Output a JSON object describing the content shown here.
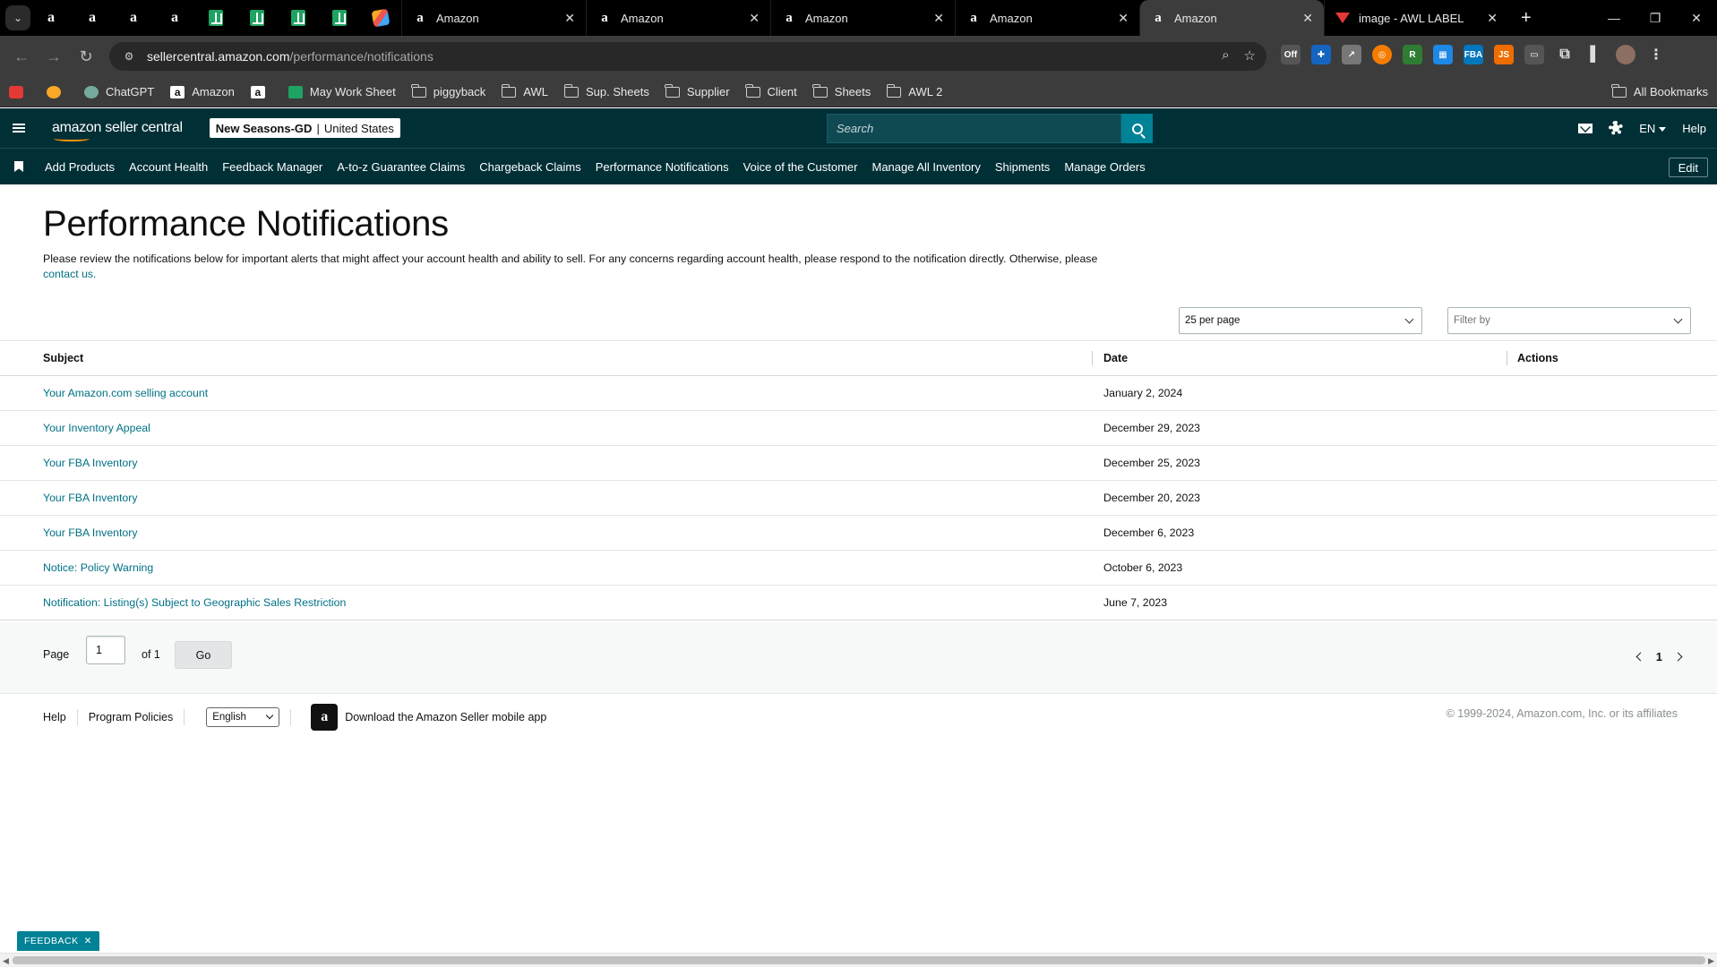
{
  "browser": {
    "pinned_tabs": [
      "amazon",
      "amazon",
      "amazon",
      "amazon",
      "sheets",
      "sheets",
      "sheets",
      "sheets",
      "multi"
    ],
    "tabs": [
      {
        "title": "Amazon"
      },
      {
        "title": "Amazon"
      },
      {
        "title": "Amazon"
      },
      {
        "title": "Amazon"
      },
      {
        "title": "Amazon"
      },
      {
        "title": "image - AWL LABEL"
      }
    ],
    "url_host": "sellercentral.amazon.com",
    "url_path": "/performance/notifications",
    "bookmarks": [
      {
        "label": "ChatGPT",
        "icon": "chatgpt-icon"
      },
      {
        "label": "Amazon",
        "icon": "amazon-icon"
      },
      {
        "label": "",
        "icon": "amazon-icon"
      },
      {
        "label": "May Work Sheet",
        "icon": "sheets-icon"
      },
      {
        "label": "piggyback",
        "icon": "folder-icon"
      },
      {
        "label": "AWL",
        "icon": "folder-icon"
      },
      {
        "label": "Sup. Sheets",
        "icon": "folder-icon"
      },
      {
        "label": "Supplier",
        "icon": "folder-icon"
      },
      {
        "label": "Client",
        "icon": "folder-icon"
      },
      {
        "label": "Sheets",
        "icon": "folder-icon"
      },
      {
        "label": "AWL 2",
        "icon": "folder-icon"
      }
    ],
    "all_bookmarks": "All Bookmarks"
  },
  "header": {
    "logo_text": "amazon seller central",
    "store_name": "New Seasons-GD",
    "marketplace": "United States",
    "search_placeholder": "Search",
    "language": "EN",
    "help": "Help"
  },
  "nav": {
    "items": [
      "Add Products",
      "Account Health",
      "Feedback Manager",
      "A-to-z Guarantee Claims",
      "Chargeback Claims",
      "Performance Notifications",
      "Voice of the Customer",
      "Manage All Inventory",
      "Shipments",
      "Manage Orders"
    ],
    "edit": "Edit"
  },
  "main": {
    "title": "Performance Notifications",
    "intro": "Please review the notifications below for important alerts that might affect your account health and ability to sell. For any concerns regarding account health, please respond to the notification directly. Otherwise, please",
    "contact_link": "contact us.",
    "per_page": "25 per page",
    "filter_placeholder": "Filter by",
    "columns": {
      "subject": "Subject",
      "date": "Date",
      "actions": "Actions"
    },
    "rows": [
      {
        "subject": "Your Amazon.com selling account",
        "date": "January 2, 2024"
      },
      {
        "subject": "Your Inventory Appeal",
        "date": "December 29, 2023"
      },
      {
        "subject": "Your FBA Inventory",
        "date": "December 25, 2023"
      },
      {
        "subject": "Your FBA Inventory",
        "date": "December 20, 2023"
      },
      {
        "subject": "Your FBA Inventory",
        "date": "December 6, 2023"
      },
      {
        "subject": "Notice: Policy Warning",
        "date": "October 6, 2023"
      },
      {
        "subject": "Notification: Listing(s) Subject to Geographic Sales Restriction",
        "date": "June 7, 2023"
      }
    ]
  },
  "pagination": {
    "page_label": "Page",
    "page_value": "1",
    "of_label": "of 1",
    "go": "Go",
    "current": "1"
  },
  "footer": {
    "help": "Help",
    "program_policies": "Program Policies",
    "language": "English",
    "app_text": "Download the Amazon Seller mobile app",
    "copyright": "© 1999-2024, Amazon.com, Inc. or its affiliates"
  },
  "feedback": "FEEDBACK",
  "colors": {
    "header_bg": "#002f36",
    "link": "#007185",
    "search_button": "#008296"
  }
}
